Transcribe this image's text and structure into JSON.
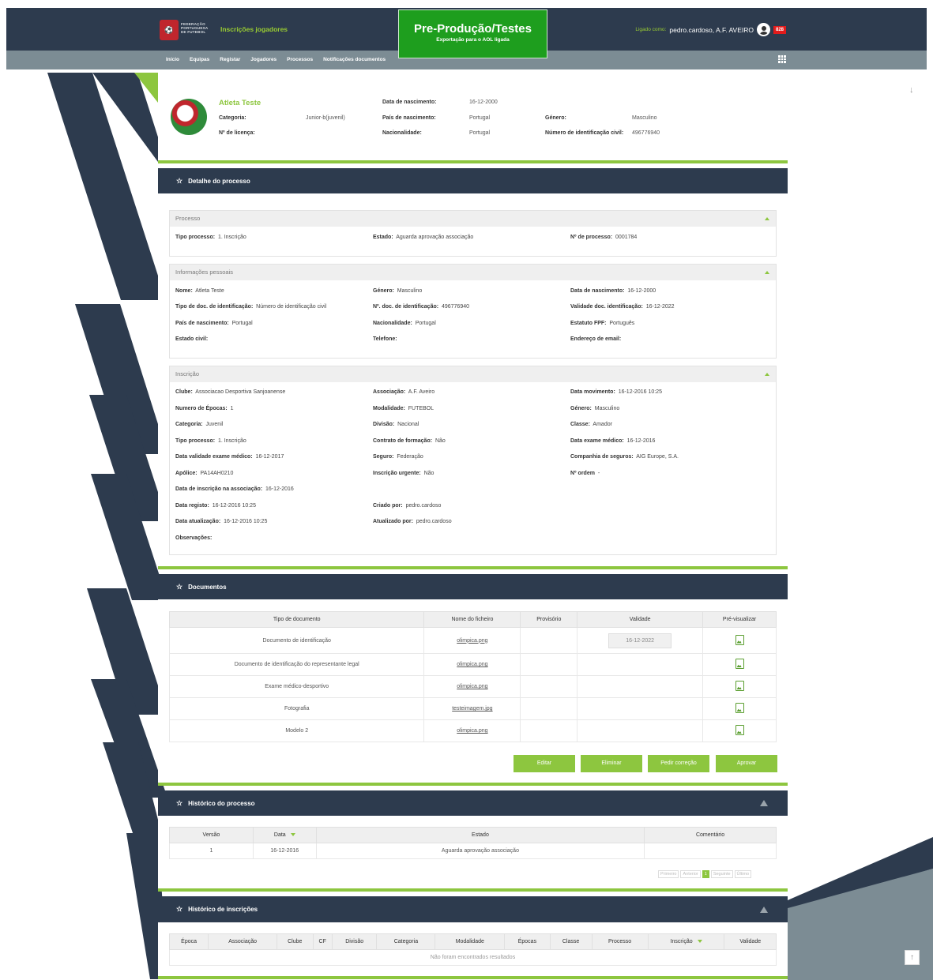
{
  "header": {
    "logo_text": [
      "FEDERAÇÃO",
      "PORTUGUESA",
      "DE FUTEBOL"
    ],
    "app_title": "Inscrições jogadores",
    "environment_title": "Pre-Produção/Testes",
    "environment_subtitle": "Exportação para o AOL ligada",
    "user_label": "Ligado como:",
    "user_name": "pedro.cardoso, A.F. AVEIRO",
    "badge_count": "828"
  },
  "nav": {
    "items": [
      "Início",
      "Equipas",
      "Registar",
      "Jogadores",
      "Processos",
      "Notificações documentos"
    ]
  },
  "profile": {
    "name": "Atleta Teste",
    "categoria_label": "Categoria:",
    "categoria": "Junior-b(juvenil)",
    "licenca_label": "Nº de licença:",
    "licenca": "",
    "nascimento_label": "Data de nascimento:",
    "nascimento": "16-12-2000",
    "pais_label": "País de nascimento:",
    "pais": "Portugal",
    "nacionalidade_label": "Nacionalidade:",
    "nacionalidade": "Portugal",
    "genero_label": "Género:",
    "genero": "Masculino",
    "id_civil_label": "Número de identificação civil:",
    "id_civil": "496776940"
  },
  "detalhe": {
    "title": "Detalhe do processo",
    "processo": {
      "title": "Processo",
      "tipo_label": "Tipo processo:",
      "tipo": "1. Inscrição",
      "estado_label": "Estado:",
      "estado": "Aguarda aprovação associação",
      "numero_label": "Nº de processo:",
      "numero": "0001784"
    },
    "pessoais": {
      "title": "Informações pessoais",
      "fields": [
        {
          "label": "Nome:",
          "value": "Atleta Teste"
        },
        {
          "label": "Género:",
          "value": "Masculino"
        },
        {
          "label": "Data de nascimento:",
          "value": "16-12-2000"
        },
        {
          "label": "Tipo de doc. de identificação:",
          "value": "Número de identificação civil"
        },
        {
          "label": "Nº. doc. de identificação:",
          "value": "496776940"
        },
        {
          "label": "Validade doc. identificação:",
          "value": "16-12-2022"
        },
        {
          "label": "País de nascimento:",
          "value": "Portugal"
        },
        {
          "label": "Nacionalidade:",
          "value": "Portugal"
        },
        {
          "label": "Estatuto FPF:",
          "value": "Português"
        },
        {
          "label": "Estado civil:",
          "value": ""
        },
        {
          "label": "Telefone:",
          "value": ""
        },
        {
          "label": "Endereço de email:",
          "value": ""
        }
      ]
    },
    "inscricao": {
      "title": "Inscrição",
      "fields": [
        {
          "label": "Clube:",
          "value": "Associacao Desportiva Sanjoanense"
        },
        {
          "label": "Associação:",
          "value": "A.F. Aveiro"
        },
        {
          "label": "Data movimento:",
          "value": "16-12-2016 10:25"
        },
        {
          "label": "Numero de Épocas:",
          "value": "1"
        },
        {
          "label": "Modalidade:",
          "value": "FUTEBOL"
        },
        {
          "label": "Género:",
          "value": "Masculino"
        },
        {
          "label": "Categoria:",
          "value": "Juvenil"
        },
        {
          "label": "Divisão:",
          "value": "Nacional"
        },
        {
          "label": "Classe:",
          "value": "Amador"
        },
        {
          "label": "Tipo processo:",
          "value": "1. Inscrição"
        },
        {
          "label": "Contrato de formação:",
          "value": "Não"
        },
        {
          "label": "Data exame médico:",
          "value": "16-12-2016"
        },
        {
          "label": "Data validade exame médico:",
          "value": "16-12-2017"
        },
        {
          "label": "Seguro:",
          "value": "Federação"
        },
        {
          "label": "Companhia de seguros:",
          "value": "AIG Europe, S.A."
        },
        {
          "label": "Apólice:",
          "value": "PA14AH0210"
        },
        {
          "label": "Inscrição urgente:",
          "value": "Não"
        },
        {
          "label": "Nº ordem",
          "value": "-"
        },
        {
          "label": "Data de inscrição na associação:",
          "value": "16-12-2016"
        },
        {
          "label": "Data registo:",
          "value": "16-12-2016 10:25"
        },
        {
          "label": "Criado por:",
          "value": "pedro.cardoso"
        },
        {
          "label": "Data atualização:",
          "value": "16-12-2016 10:25"
        },
        {
          "label": "Atualizado por:",
          "value": "pedro.cardoso"
        },
        {
          "label": "Observações:",
          "value": ""
        }
      ]
    }
  },
  "documentos": {
    "title": "Documentos",
    "columns": [
      "Tipo de documento",
      "Nome do ficheiro",
      "Provisório",
      "Validade",
      "Pré-visualizar"
    ],
    "rows": [
      {
        "tipo": "Documento de identificação",
        "ficheiro": "olimpica.png",
        "provisorio": "",
        "validade": "16-12-2022"
      },
      {
        "tipo": "Documento de identificação do representante legal",
        "ficheiro": "olimpica.png",
        "provisorio": "",
        "validade": ""
      },
      {
        "tipo": "Exame médico-desportivo",
        "ficheiro": "olimpica.png",
        "provisorio": "",
        "validade": ""
      },
      {
        "tipo": "Fotografia",
        "ficheiro": "testeimagem.jpg",
        "provisorio": "",
        "validade": ""
      },
      {
        "tipo": "Modelo 2",
        "ficheiro": "olimpica.png",
        "provisorio": "",
        "validade": ""
      }
    ],
    "buttons": [
      "Editar",
      "Eliminar",
      "Pedir correção",
      "Aprovar"
    ]
  },
  "historico_processo": {
    "title": "Histórico do processo",
    "columns": [
      "Versão",
      "Data",
      "Estado",
      "Comentário"
    ],
    "rows": [
      {
        "versao": "1",
        "data": "16-12-2016",
        "estado": "Aguarda aprovação associação",
        "comentario": ""
      }
    ],
    "pager": [
      "Primeiro",
      "Anterior",
      "1",
      "Seguinte",
      "Último"
    ]
  },
  "historico_inscricoes": {
    "title": "Histórico de inscrições",
    "columns": [
      "Época",
      "Associação",
      "Clube",
      "CF",
      "Divisão",
      "Categoria",
      "Modalidade",
      "Épocas",
      "Classe",
      "Processo",
      "Inscrição",
      "Validade"
    ],
    "empty_text": "Não foram encontrados resultados"
  },
  "colors": {
    "dark": "#2d3b4e",
    "accent_green": "#8dc63f",
    "env_green": "#1e9e1e",
    "nav_gray": "#7c8c94"
  }
}
